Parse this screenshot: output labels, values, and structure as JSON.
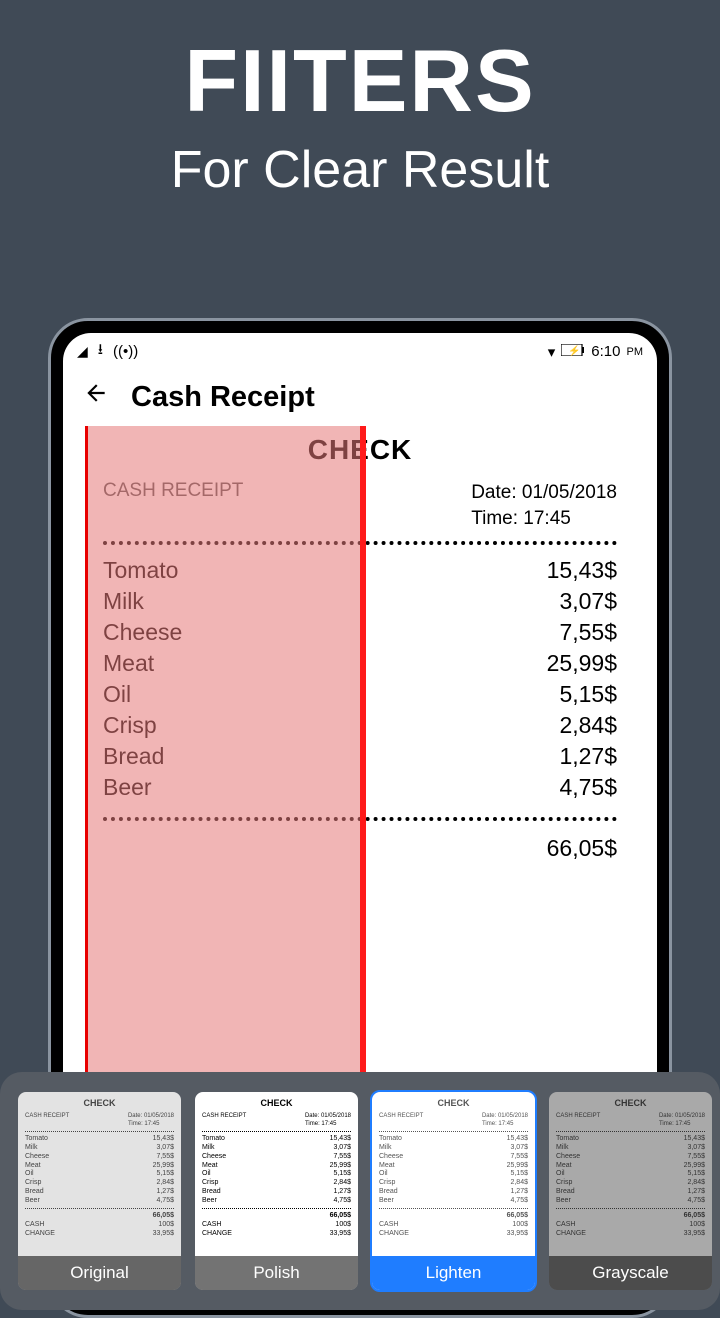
{
  "promo": {
    "title": "FIITERS",
    "subtitle": "For Clear Result"
  },
  "status": {
    "time": "6:10",
    "ampm": "PM"
  },
  "header": {
    "title": "Cash Receipt"
  },
  "receipt": {
    "title": "CHECK",
    "subtitle": "CASH RECEIPT",
    "date_label": "Date: 01/05/2018",
    "time_label": "Time: 17:45",
    "items": [
      {
        "name": "Tomato",
        "price": "15,43$"
      },
      {
        "name": "Milk",
        "price": "3,07$"
      },
      {
        "name": "Cheese",
        "price": "7,55$"
      },
      {
        "name": "Meat",
        "price": "25,99$"
      },
      {
        "name": "Oil",
        "price": "5,15$"
      },
      {
        "name": "Crisp",
        "price": "2,84$"
      },
      {
        "name": "Bread",
        "price": "1,27$"
      },
      {
        "name": "Beer",
        "price": "4,75$"
      }
    ],
    "partial_total": "66,05$",
    "footer": {
      "cash": "CASH",
      "cash_val": "100$",
      "change": "CHANGE",
      "change_val": "33,95$",
      "total": "66,05$"
    }
  },
  "filters": {
    "options": [
      {
        "label": "Original",
        "style": "original",
        "selected": false
      },
      {
        "label": "Polish",
        "style": "polish",
        "selected": false
      },
      {
        "label": "Lighten",
        "style": "lighten",
        "selected": true
      },
      {
        "label": "Grayscale",
        "style": "grayscale",
        "selected": false
      }
    ]
  }
}
